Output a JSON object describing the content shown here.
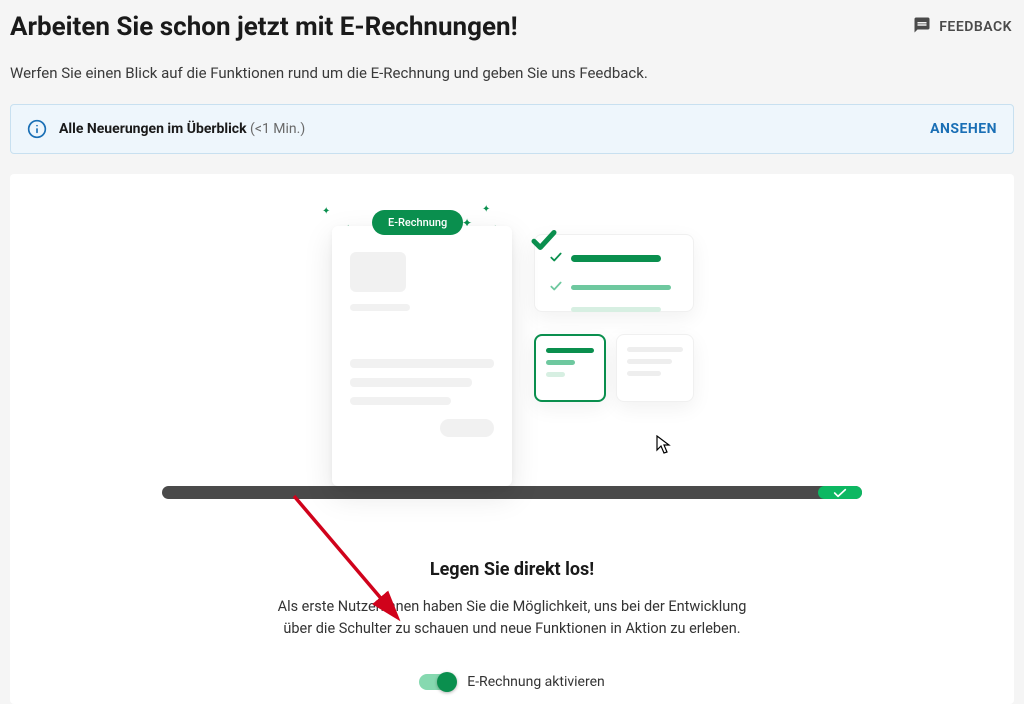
{
  "header": {
    "title": "Arbeiten Sie schon jetzt mit E-Rechnungen!",
    "feedback_label": "FEEDBACK",
    "subtitle": "Werfen Sie einen Blick auf die Funktionen rund um die E-Rechnung und geben Sie uns Feedback."
  },
  "banner": {
    "text_bold": "Alle Neuerungen im Überblick",
    "text_suffix": " (<1 Min.)",
    "action": "ANSEHEN"
  },
  "illustration": {
    "pill_label": "E-Rechnung"
  },
  "cta": {
    "title": "Legen Sie direkt los!",
    "body_line1": "Als erste Nutzer:innen haben Sie die Möglichkeit, uns bei der Entwicklung",
    "body_line2": "über die Schulter zu schauen und neue Funktionen in Aktion zu erleben.",
    "toggle_label": "E-Rechnung aktivieren",
    "toggle_state": true
  }
}
